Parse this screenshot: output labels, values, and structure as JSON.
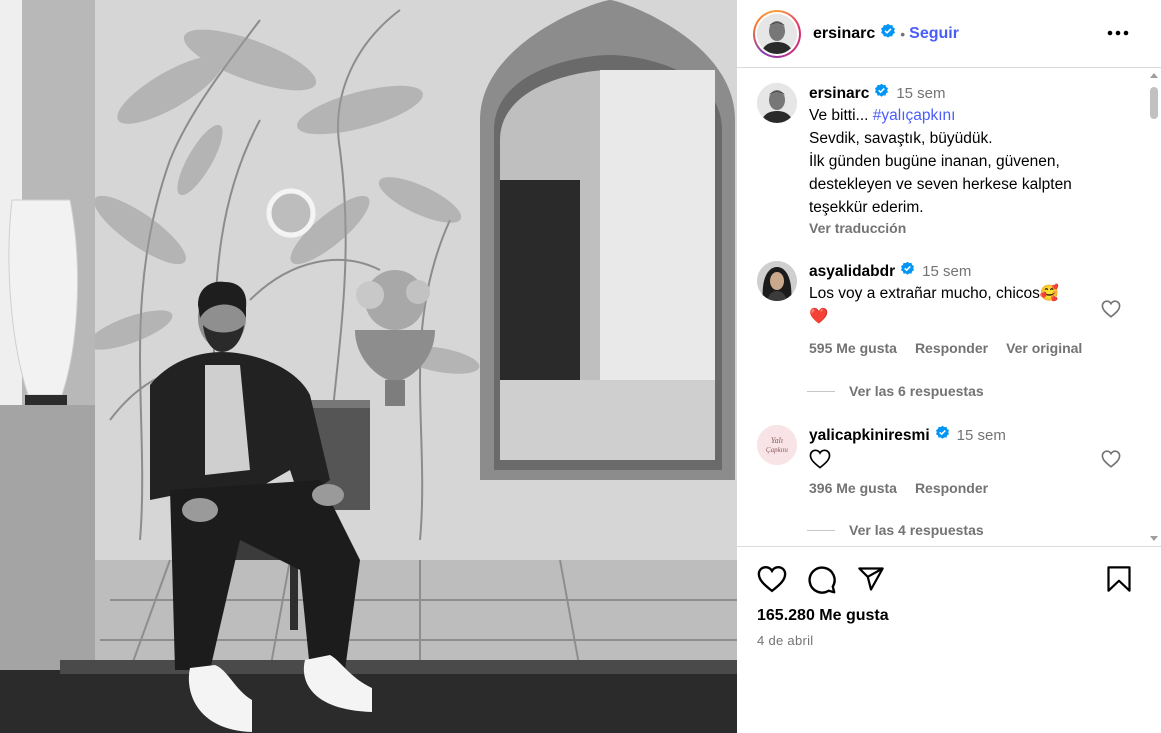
{
  "post": {
    "author": "ersinarc",
    "follow_label": "Seguir",
    "separator": "•",
    "caption_time": "15 sem",
    "caption_lines": [
      "Ve bitti...",
      "Sevdik, savaştık, büyüdük.",
      "İlk günden bugüne inanan, güvenen,",
      "destekleyen ve seven herkese kalpten",
      "teşekkür ederim."
    ],
    "hashtag": "#yalıçapkını",
    "translate_label": "Ver traducción",
    "likes": "165.280 Me gusta",
    "date": "4 de abril"
  },
  "comments": [
    {
      "user": "asyalidabdr",
      "time": "15 sem",
      "text": "Los voy a extrañar mucho, chicos",
      "emoji": "🥰",
      "second_line_emoji": "❤️",
      "likes": "595 Me gusta",
      "reply_label": "Responder",
      "original_label": "Ver original",
      "view_replies": "Ver las 6 respuestas"
    },
    {
      "user": "yalicapkiniresmi",
      "time": "15 sem",
      "text": "",
      "avatar_text": "Yalı Çapkını",
      "likes": "396 Me gusta",
      "reply_label": "Responder",
      "view_replies": "Ver las 4 respuestas"
    }
  ],
  "colors": {
    "accent": "#4a5df9",
    "verified": "#0095f6",
    "muted": "#737373",
    "heart_red": "#e0245e"
  },
  "icons": [
    "more-options-icon",
    "verified-badge-icon",
    "heart-icon",
    "comment-icon",
    "share-icon",
    "bookmark-icon"
  ]
}
